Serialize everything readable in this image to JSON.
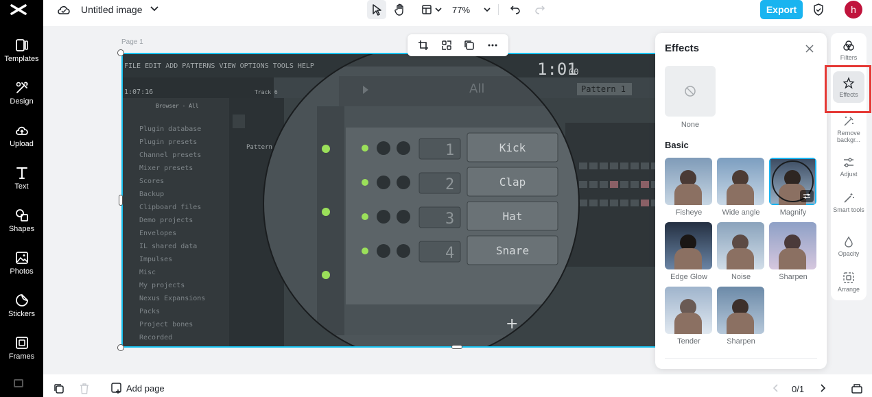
{
  "topbar": {
    "title": "Untitled image",
    "zoom": "77%",
    "export_label": "Export",
    "avatar_initial": "h"
  },
  "sidebar": {
    "items": [
      {
        "label": "Templates",
        "icon": "templates-icon"
      },
      {
        "label": "Design",
        "icon": "design-icon"
      },
      {
        "label": "Upload",
        "icon": "upload-icon"
      },
      {
        "label": "Text",
        "icon": "text-icon"
      },
      {
        "label": "Shapes",
        "icon": "shapes-icon"
      },
      {
        "label": "Photos",
        "icon": "photos-icon"
      },
      {
        "label": "Stickers",
        "icon": "stickers-icon"
      },
      {
        "label": "Frames",
        "icon": "frames-icon"
      }
    ]
  },
  "canvas": {
    "page_label": "Page 1",
    "art": {
      "menu": "FILE EDIT ADD PATTERNS VIEW OPTIONS TOOLS HELP",
      "time": "1:01",
      "time_small": "00",
      "position": "1:07:16",
      "track": "Track 6",
      "browser_title": "Browser - All",
      "all_label": "All",
      "pattern_label": "Pattern 1",
      "pattern_item": "Pattern 1",
      "channels": [
        {
          "num": "1",
          "name": "Kick"
        },
        {
          "num": "2",
          "name": "Clap"
        },
        {
          "num": "3",
          "name": "Hat"
        },
        {
          "num": "4",
          "name": "Snare"
        }
      ],
      "browser_items": [
        "Plugin database",
        "Plugin presets",
        "Channel presets",
        "Mixer presets",
        "Scores",
        "Backup",
        "Clipboard files",
        "Demo projects",
        "Envelopes",
        "IL shared data",
        "Impulses",
        "Misc",
        "My projects",
        "Nexus Expansions",
        "Packs",
        "Project bones",
        "Recorded"
      ]
    }
  },
  "effects": {
    "title": "Effects",
    "none_label": "None",
    "section": "Basic",
    "tiles": [
      "Fisheye",
      "Wide angle",
      "Magnify",
      "Edge Glow",
      "Noise",
      "Sharpen",
      "Tender",
      "Sharpen"
    ]
  },
  "right_toolbar": {
    "items": [
      "Filters",
      "Effects",
      "Remove backgr...",
      "Adjust",
      "Smart tools",
      "Opacity",
      "Arrange"
    ]
  },
  "bottombar": {
    "add_page": "Add page",
    "page_counter": "0/1"
  },
  "colors": {
    "accent": "#19b4f0",
    "highlight_box": "#e53935",
    "avatar": "#c0143c"
  }
}
